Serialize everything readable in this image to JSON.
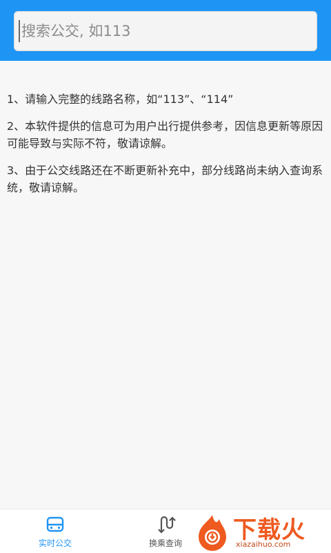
{
  "search": {
    "placeholder": "搜索公交, 如113"
  },
  "notices": [
    "1、请输入完整的线路名称，如“113”、“114”",
    "2、本软件提供的信息可为用户出行提供参考，因信息更新等原因可能导致与实际不符，敬请谅解。",
    "3、由于公交线路还在不断更新补充中，部分线路尚未纳入查询系统，敬请谅解。"
  ],
  "tabs": {
    "realtime": {
      "label": "实时公交",
      "icon": "bus-icon"
    },
    "transfer": {
      "label": "换乘查询",
      "icon": "transfer-icon"
    }
  },
  "watermark": {
    "title": "下载火",
    "subtitle": "xiazaihuo.com"
  },
  "colors": {
    "primary": "#1e94f5",
    "watermark": "#ee5a20"
  }
}
